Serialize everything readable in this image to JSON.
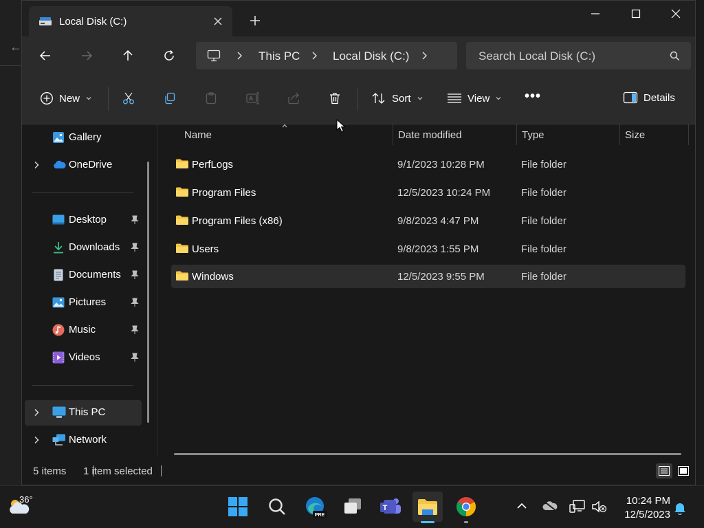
{
  "tab": {
    "title": "Local Disk (C:)",
    "new_tab": "+"
  },
  "window_controls": {
    "minimize": "—",
    "maximize": "☐",
    "close": "✕"
  },
  "breadcrumb": {
    "items": [
      "This PC",
      "Local Disk (C:)"
    ]
  },
  "search": {
    "placeholder": "Search Local Disk (C:)"
  },
  "toolbar": {
    "new_label": "New",
    "sort_label": "Sort",
    "view_label": "View",
    "more_label": "•••",
    "details_label": "Details"
  },
  "sidebar": {
    "top_items": [
      {
        "label": "Gallery",
        "icon": "gallery-icon"
      },
      {
        "label": "OneDrive",
        "icon": "onedrive-icon"
      }
    ],
    "quick_access": [
      {
        "label": "Desktop",
        "icon": "desktop-icon"
      },
      {
        "label": "Downloads",
        "icon": "downloads-icon"
      },
      {
        "label": "Documents",
        "icon": "documents-icon"
      },
      {
        "label": "Pictures",
        "icon": "pictures-icon"
      },
      {
        "label": "Music",
        "icon": "music-icon"
      },
      {
        "label": "Videos",
        "icon": "videos-icon"
      }
    ],
    "bottom_items": [
      {
        "label": "This PC",
        "icon": "this-pc-icon"
      },
      {
        "label": "Network",
        "icon": "network-icon"
      }
    ]
  },
  "table": {
    "columns": [
      "Name",
      "Date modified",
      "Type",
      "Size"
    ],
    "rows": [
      {
        "name": "PerfLogs",
        "date": "9/1/2023 10:28 PM",
        "type": "File folder"
      },
      {
        "name": "Program Files",
        "date": "12/5/2023 10:24 PM",
        "type": "File folder"
      },
      {
        "name": "Program Files (x86)",
        "date": "9/8/2023 4:47 PM",
        "type": "File folder"
      },
      {
        "name": "Users",
        "date": "9/8/2023 1:55 PM",
        "type": "File folder"
      },
      {
        "name": "Windows",
        "date": "12/5/2023 9:55 PM",
        "type": "File folder"
      }
    ],
    "selected_row": "Windows"
  },
  "status": {
    "item_count": "5 items",
    "selection": "1 item selected"
  },
  "taskbar": {
    "weather_temp": "36°",
    "time": "10:24 PM",
    "date": "12/5/2023",
    "edge_badge": "PRE"
  },
  "colors": {
    "accent": "#4cc2ff",
    "folder": "#f4c542",
    "selection": "#2d2d2d"
  }
}
